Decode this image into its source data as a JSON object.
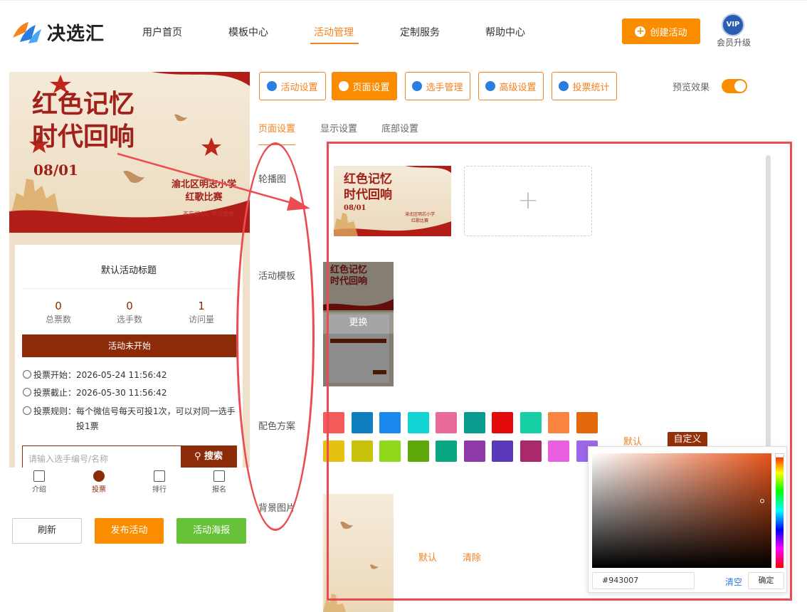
{
  "brand": {
    "name": "决选汇"
  },
  "nav": {
    "items": [
      {
        "label": "用户首页"
      },
      {
        "label": "模板中心"
      },
      {
        "label": "活动管理"
      },
      {
        "label": "定制服务"
      },
      {
        "label": "帮助中心"
      }
    ],
    "active_index": 2,
    "create_label": "创建活动",
    "vip_badge": "VIP",
    "vip_label": "会员升级"
  },
  "preview": {
    "banner": {
      "title_line1": "红色记忆",
      "title_line2": "时代回响",
      "date": "08/01",
      "school_line1": "渝北区明志小学",
      "school_line2": "红歌比赛",
      "slogan": "不忘初心，牢记使命"
    },
    "card_title": "默认活动标题",
    "stats": [
      {
        "value": "0",
        "label": "总票数"
      },
      {
        "value": "0",
        "label": "选手数"
      },
      {
        "value": "1",
        "label": "访问量"
      }
    ],
    "status": "活动未开始",
    "vote_start": "投票开始：2026-05-24 11:56:42",
    "vote_end": "投票截止：2026-05-30 11:56:42",
    "vote_rule_1": "投票规则：每个微信号每天可投1次，可以对同一选手",
    "vote_rule_2": "投1票",
    "search_placeholder": "请输入选手编号/名称",
    "search_button": "搜索",
    "tabs": [
      {
        "label": "介绍"
      },
      {
        "label": "投票"
      },
      {
        "label": "排行"
      },
      {
        "label": "报名"
      }
    ],
    "active_tab": 1
  },
  "actions": {
    "refresh": "刷新",
    "publish": "发布活动",
    "poster": "活动海报"
  },
  "settings_tabs": [
    {
      "label": "活动设置"
    },
    {
      "label": "页面设置"
    },
    {
      "label": "选手管理"
    },
    {
      "label": "高级设置"
    },
    {
      "label": "投票统计"
    }
  ],
  "settings_active": 1,
  "preview_toggle": {
    "label": "预览效果",
    "on": true
  },
  "sub_tabs": [
    {
      "label": "页面设置"
    },
    {
      "label": "显示设置"
    },
    {
      "label": "底部设置"
    }
  ],
  "rows": {
    "carousel": "轮播图",
    "template": "活动模板",
    "template_change": "更换",
    "color_scheme": "配色方案",
    "bg_image": "背景图片"
  },
  "color_scheme": {
    "swatches": [
      "#f35b5b",
      "#0f7fbf",
      "#1a88ec",
      "#11d3d3",
      "#e86a9b",
      "#0a9a8e",
      "#e50a0a",
      "#18d0a5",
      "#fb8342",
      "#e4680c",
      "#e6c210",
      "#c8c20a",
      "#90d81a",
      "#5ea80a",
      "#0aa882",
      "#8e3aa8",
      "#5a3ab8",
      "#a82a6a",
      "#e860e0",
      "#9a68e8"
    ],
    "default_label": "默认",
    "custom_label": "自定义"
  },
  "background": {
    "default_label": "默认",
    "clear_label": "清除"
  },
  "color_picker": {
    "hex_value": "#943007",
    "clear_label": "清空",
    "confirm_label": "确定"
  },
  "colors": {
    "accent": "#fb8c00",
    "brand_red": "#943007",
    "annotation_red": "#ec4b52"
  }
}
